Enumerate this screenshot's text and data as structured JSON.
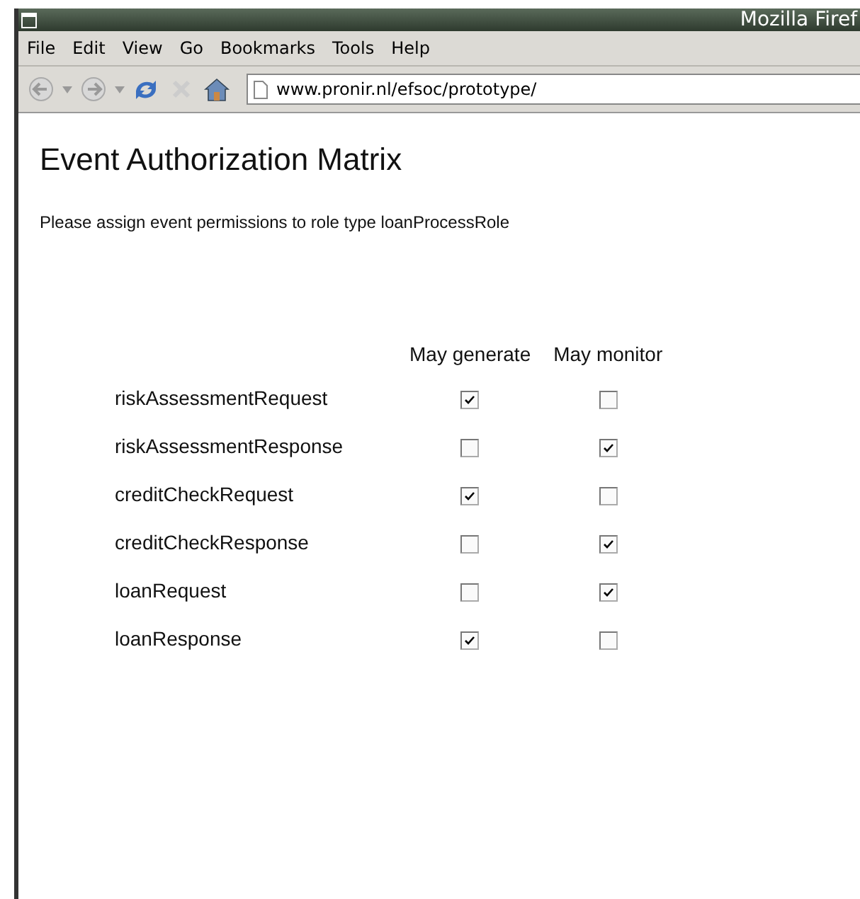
{
  "window": {
    "title": "Mozilla Firef"
  },
  "menu": [
    "File",
    "Edit",
    "View",
    "Go",
    "Bookmarks",
    "Tools",
    "Help"
  ],
  "address": {
    "value": "www.pronir.nl/efsoc/prototype/"
  },
  "page": {
    "heading": "Event Authorization Matrix",
    "intro": "Please assign event permissions to role type loanProcessRole",
    "columns": [
      "May generate",
      "May monitor"
    ],
    "rows": [
      {
        "event": "riskAssessmentRequest",
        "generate": true,
        "monitor": false
      },
      {
        "event": "riskAssessmentResponse",
        "generate": false,
        "monitor": true
      },
      {
        "event": "creditCheckRequest",
        "generate": true,
        "monitor": false
      },
      {
        "event": "creditCheckResponse",
        "generate": false,
        "monitor": true
      },
      {
        "event": "loanRequest",
        "generate": false,
        "monitor": true
      },
      {
        "event": "loanResponse",
        "generate": true,
        "monitor": false
      }
    ]
  }
}
